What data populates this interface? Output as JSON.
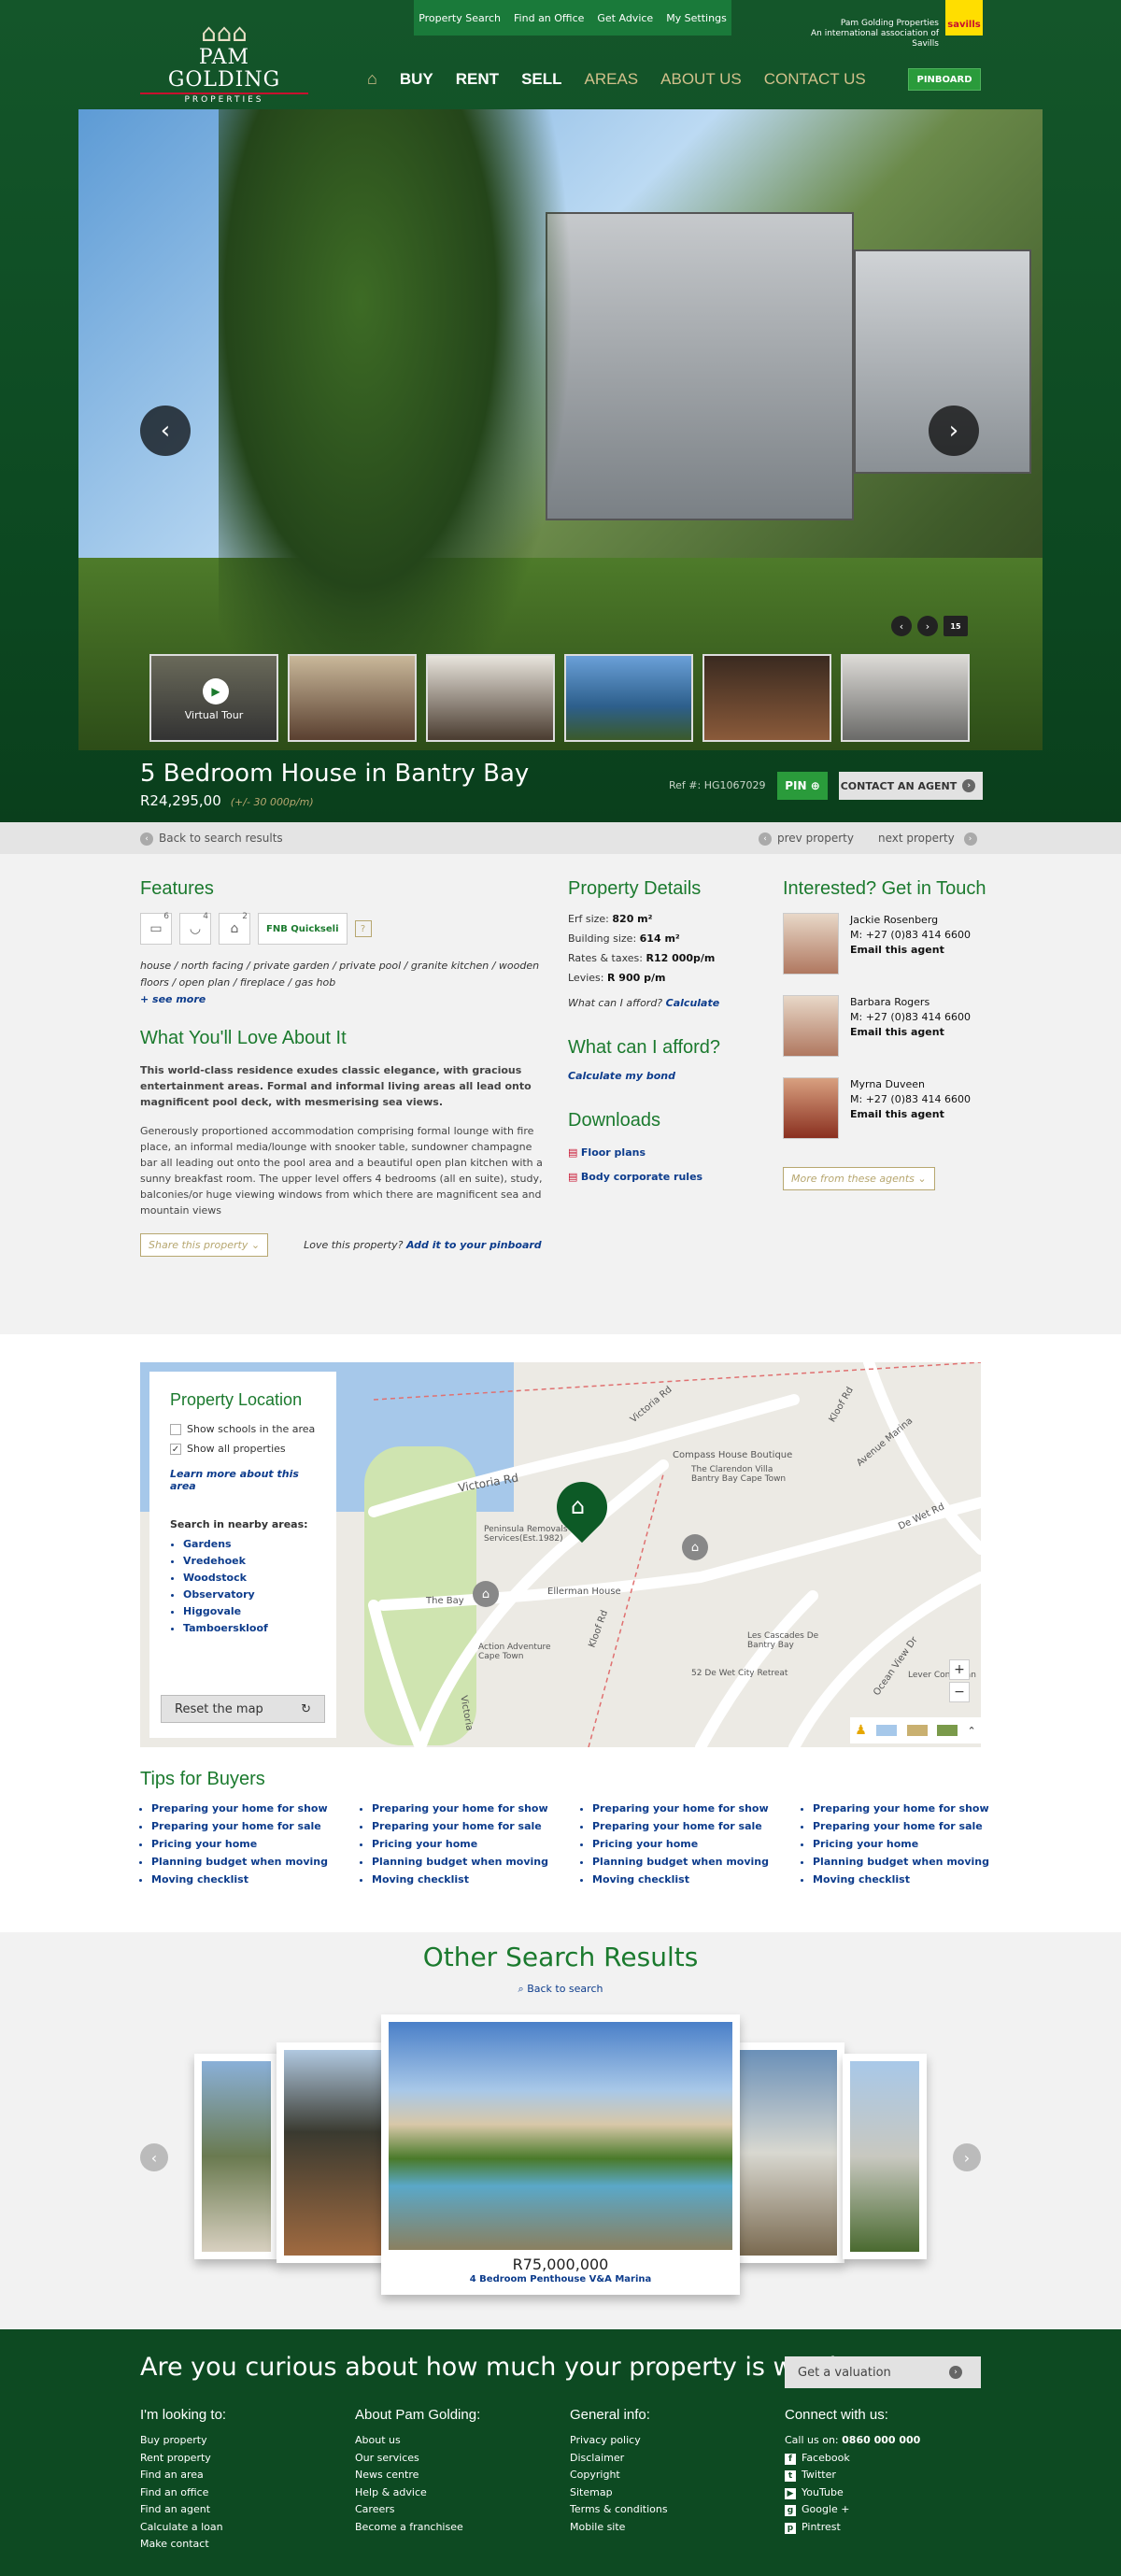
{
  "brand": {
    "name": "PAM GOLDING",
    "sub": "PROPERTIES",
    "assoc_1": "Pam Golding Properties",
    "assoc_2": "An international association of Savills",
    "partner": "savills",
    "green": "#0d4a22",
    "accent": "#2a9b3b",
    "tan": "#b7a770"
  },
  "topbar": [
    "Property Search",
    "Find an Office",
    "Get Advice",
    "My Settings"
  ],
  "nav": {
    "home_icon": "home-icon",
    "items": [
      "BUY",
      "RENT",
      "SELL",
      "AREAS",
      "ABOUT US",
      "CONTACT US"
    ],
    "pinboard": "PINBOARD"
  },
  "hero": {
    "virtual_tour": "Virtual Tour",
    "photo_count": "15"
  },
  "property": {
    "title": "5 Bedroom House in Bantry Bay",
    "price": "R24,295,00",
    "price_note": "(+/- 30 000p/m)",
    "ref": "Ref #: HG1067029",
    "pin": "PIN",
    "contact": "CONTACT AN AGENT"
  },
  "backbar": {
    "back": "Back to search results",
    "prev": "prev property",
    "next": "next property"
  },
  "features": {
    "heading": "Features",
    "counts": [
      "6",
      "4",
      "2"
    ],
    "fnb": "FNB Quickseli",
    "help": "?",
    "tags": "house  /  north facing  /  private garden  /  private pool  /  granite kitchen  /  wooden floors  /  open plan  /  fireplace  /  gas hob",
    "see_more": "+ see more"
  },
  "love": {
    "heading": "What You'll Love About It",
    "intro": "This world-class residence exudes classic elegance, with gracious entertainment areas. Formal and informal living areas all lead onto magnificent pool deck, with mesmerising sea views.",
    "body": "Generously proportioned accommodation comprising formal lounge with fire place, an informal media/lounge with snooker table, sundowner champagne bar all leading out onto the pool area and a beautiful open plan kitchen with a sunny breakfast room. The upper level offers 4 bedrooms (all en suite), study, balconies/or huge viewing windows from which there are magnificent sea and mountain views",
    "share": "Share this property",
    "love_q": "Love this property?",
    "add": "Add it to your  pinboard"
  },
  "details": {
    "heading": "Property Details",
    "rows": [
      {
        "k": "Erf size:",
        "v": "820 m²"
      },
      {
        "k": "Building size:",
        "v": "614 m²"
      },
      {
        "k": "Rates & taxes:",
        "v": "R12 000p/m"
      },
      {
        "k": "Levies:",
        "v": "R 900 p/m"
      }
    ],
    "afford_q": "What can I afford?",
    "calc": "Calculate",
    "afford_heading": "What can  I afford?",
    "bond": "Calculate my bond",
    "downloads_heading": "Downloads",
    "downloads": [
      "Floor plans",
      "Body corporate rules"
    ]
  },
  "agents": {
    "heading": "Interested? Get in Touch",
    "list": [
      {
        "name": "Jackie Rosenberg",
        "phone": "M: +27 (0)83 414 6600",
        "email": "Email this agent"
      },
      {
        "name": "Barbara Rogers",
        "phone": "M: +27 (0)83 414 6600",
        "email": "Email this agent"
      },
      {
        "name": "Myrna Duveen",
        "phone": "M: +27 (0)83 414 6600",
        "email": "Email this agent"
      }
    ],
    "more": "More from these agents"
  },
  "map": {
    "heading": "Property Location",
    "show_schools": "Show schools in the area",
    "show_all": "Show all properties",
    "learn": "Learn more about this area",
    "nearby_heading": "Search in nearby areas:",
    "nearby": [
      "Gardens",
      "Vredehoek",
      "Woodstock",
      "Observatory",
      "Higgovale",
      "Tamboerskloof"
    ],
    "reset": "Reset  the map",
    "labels": [
      "Victoria Rd",
      "Victoria Rd",
      "Compass House Boutique",
      "The Clarendon Villa Bantry Bay Cape Town",
      "Kloof Rd",
      "Avenue Marina",
      "De Wet Rd",
      "Peninsula Removals Services(Est.1982)",
      "Ellerman House",
      "The Bay",
      "Action Adventure Cape Town",
      "Kloof Rd",
      "Les Cascades De Bantry Bay",
      "52 De Wet City Retreat",
      "Ocean View Dr",
      "Lever Consultan",
      "Victoria"
    ]
  },
  "tips": {
    "heading": "Tips for Buyers",
    "items": [
      "Preparing your home for show",
      "Preparing your home for sale",
      "Pricing your home",
      "Planning budget when moving",
      "Moving checklist"
    ]
  },
  "others": {
    "heading": "Other Search Results",
    "back": "Back to search",
    "price": "R75,000,000",
    "name": "4 Bedroom Penthouse V&A Marina"
  },
  "footer": {
    "headline": "Are you curious about how much your property is worth?",
    "valuation": "Get a valuation",
    "cols": [
      {
        "h": "I'm looking to:",
        "items": [
          "Buy property",
          "Rent property",
          "Find an area",
          "Find an office",
          "Find an agent",
          "Calculate a loan",
          "Make contact"
        ]
      },
      {
        "h": "About Pam Golding:",
        "items": [
          "About us",
          "Our services",
          "News centre",
          "Help & advice",
          "Careers",
          "Become a franchisee"
        ]
      },
      {
        "h": "General info:",
        "items": [
          "Privacy policy",
          "Disclaimer",
          "Copyright",
          "Sitemap",
          "Terms & conditions",
          "Mobile site"
        ]
      }
    ],
    "connect": {
      "h": "Connect with us:",
      "call": "Call us on:",
      "phone": "0860 000 000",
      "social": [
        {
          "icon": "facebook-icon",
          "label": "Facebook",
          "g": "f"
        },
        {
          "icon": "twitter-icon",
          "label": "Twitter",
          "g": "t"
        },
        {
          "icon": "youtube-icon",
          "label": "YouTube",
          "g": "▶"
        },
        {
          "icon": "googleplus-icon",
          "label": "Google +",
          "g": "g"
        },
        {
          "icon": "pinterest-icon",
          "label": "Pintrest",
          "g": "p"
        }
      ]
    }
  }
}
